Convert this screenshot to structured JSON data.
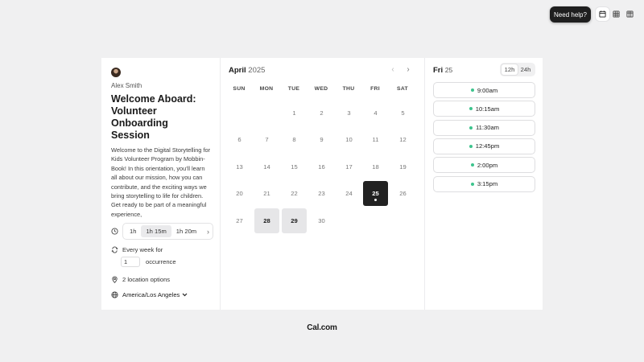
{
  "topbar": {
    "help_label": "Need help?",
    "views": [
      {
        "icon": "calendar-month-icon",
        "active": true
      },
      {
        "icon": "week-grid-icon",
        "active": false
      },
      {
        "icon": "column-view-icon",
        "active": false
      }
    ]
  },
  "event": {
    "host_name": "Alex Smith",
    "title": "Welcome Aboard: Volunteer Onboarding Session",
    "description": "Welcome to the Digital Storytelling for Kids Volunteer Program by Mobbin-Book! In this orientation, you'll learn all about our mission, how you can contribute, and the exciting ways we bring storytelling to life for children. Get ready to be part of a meaningful experience,",
    "durations": [
      "1h",
      "1h 15m",
      "1h 20m"
    ],
    "selected_duration": "1h 15m",
    "recurring_label": "Every week for",
    "occurrence_value": "1",
    "occurrence_label": "occurrence",
    "location_label": "2 location options",
    "timezone": "America/Los Angeles"
  },
  "calendar": {
    "month": "April",
    "year": "2025",
    "weekdays": [
      "SUN",
      "MON",
      "TUE",
      "WED",
      "THU",
      "FRI",
      "SAT"
    ],
    "first_weekday_index": 2,
    "days_in_month": 30,
    "selected_day": 25,
    "available_days": [
      28,
      29
    ]
  },
  "slots": {
    "day_label": "Fri",
    "day_number": "25",
    "format_options": [
      "12h",
      "24h"
    ],
    "selected_format": "12h",
    "times": [
      "9:00am",
      "10:15am",
      "11:30am",
      "12:45pm",
      "2:00pm",
      "3:15pm"
    ],
    "available_color": "#3dc48d"
  },
  "footer": {
    "brand": "Cal.com"
  }
}
